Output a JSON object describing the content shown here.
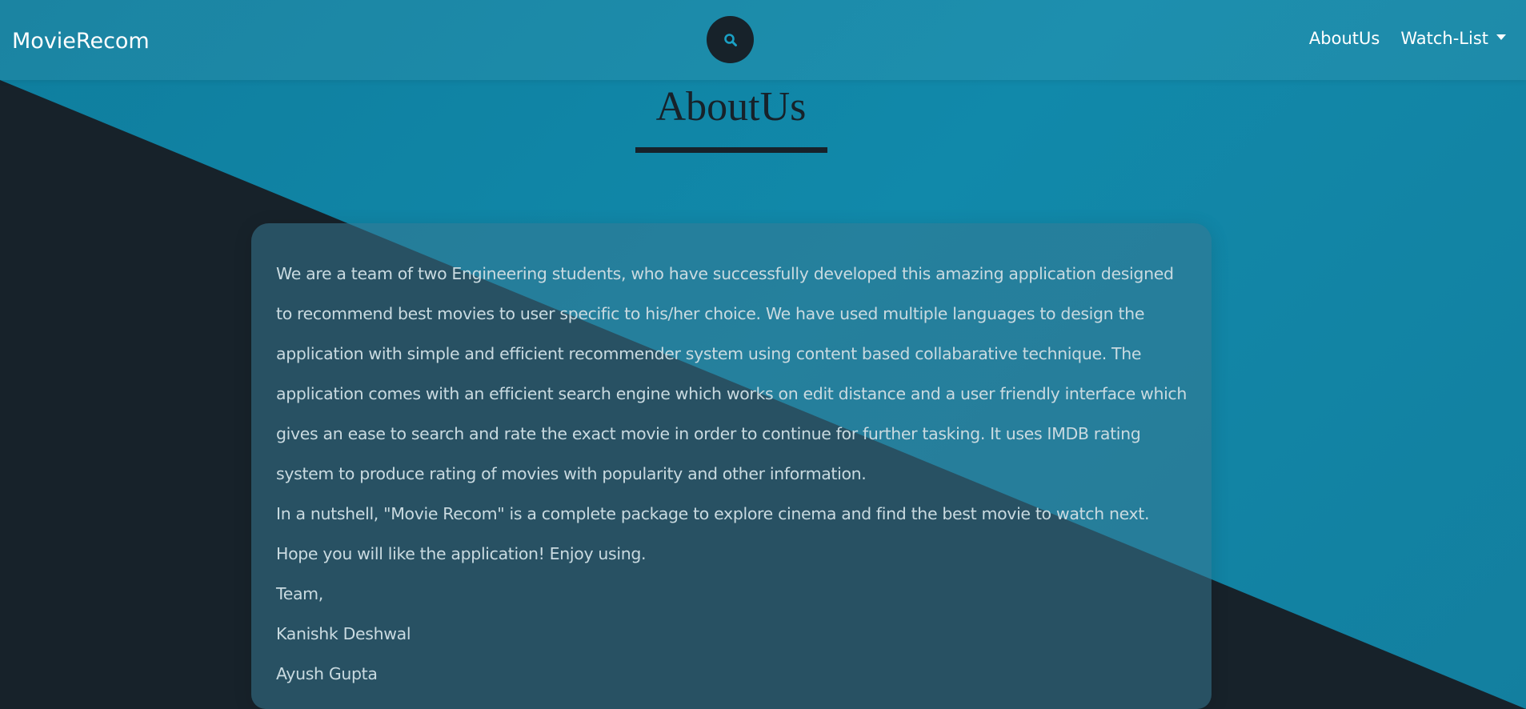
{
  "navbar": {
    "brand": "MovieRecom",
    "search_icon": "search-icon",
    "links": {
      "about": "AboutUs",
      "watchlist": "Watch-List"
    }
  },
  "colors": {
    "background_primary": "#1189aa",
    "background_dark": "#17222a",
    "text_light": "#c9dae0",
    "title": "#17222a"
  },
  "main": {
    "title": "AboutUs",
    "paragraphs": [
      "We are a team of two Engineering students, who have successfully developed this amazing application designed to recommend best movies to user specific to his/her choice. We have used multiple languages to design the application with simple and efficient recommender system using content based collabarative technique. The application comes with an efficient search engine which works on edit distance and a user friendly interface which gives an ease to search and rate the exact movie in order to continue for further tasking. It uses IMDB rating system to produce rating of movies with popularity and other information.",
      "In a nutshell, \"Movie Recom\" is a complete package to explore cinema and find the best movie to watch next.",
      "Hope you will like the application! Enjoy using.",
      "Team,",
      "Kanishk Deshwal",
      "Ayush Gupta"
    ]
  }
}
